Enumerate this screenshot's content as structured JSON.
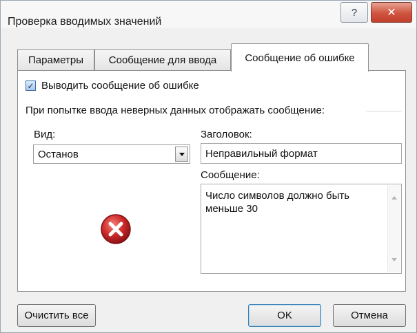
{
  "window": {
    "title": "Проверка вводимых значений",
    "help_glyph": "?",
    "close_glyph": "✕"
  },
  "tabs": [
    {
      "label": "Параметры",
      "active": false
    },
    {
      "label": "Сообщение для ввода",
      "active": false
    },
    {
      "label": "Сообщение об ошибке",
      "active": true
    }
  ],
  "error_tab": {
    "show_error_checkbox": {
      "label": "Выводить сообщение об ошибке",
      "checked": true
    },
    "instruction": "При попытке ввода неверных данных отображать сообщение:",
    "style": {
      "label": "Вид:",
      "value": "Останов"
    },
    "title": {
      "label": "Заголовок:",
      "value": "Неправильный формат"
    },
    "message": {
      "label": "Сообщение:",
      "value": "Число символов должно быть\nменьше 30"
    },
    "icon": "error-stop-icon"
  },
  "buttons": {
    "clear_all": "Очистить все",
    "ok": "OK",
    "cancel": "Отмена"
  },
  "colors": {
    "close_button": "#c9503c",
    "error_icon": "#c8262a",
    "dialog_bg": "#f0f0f0"
  }
}
